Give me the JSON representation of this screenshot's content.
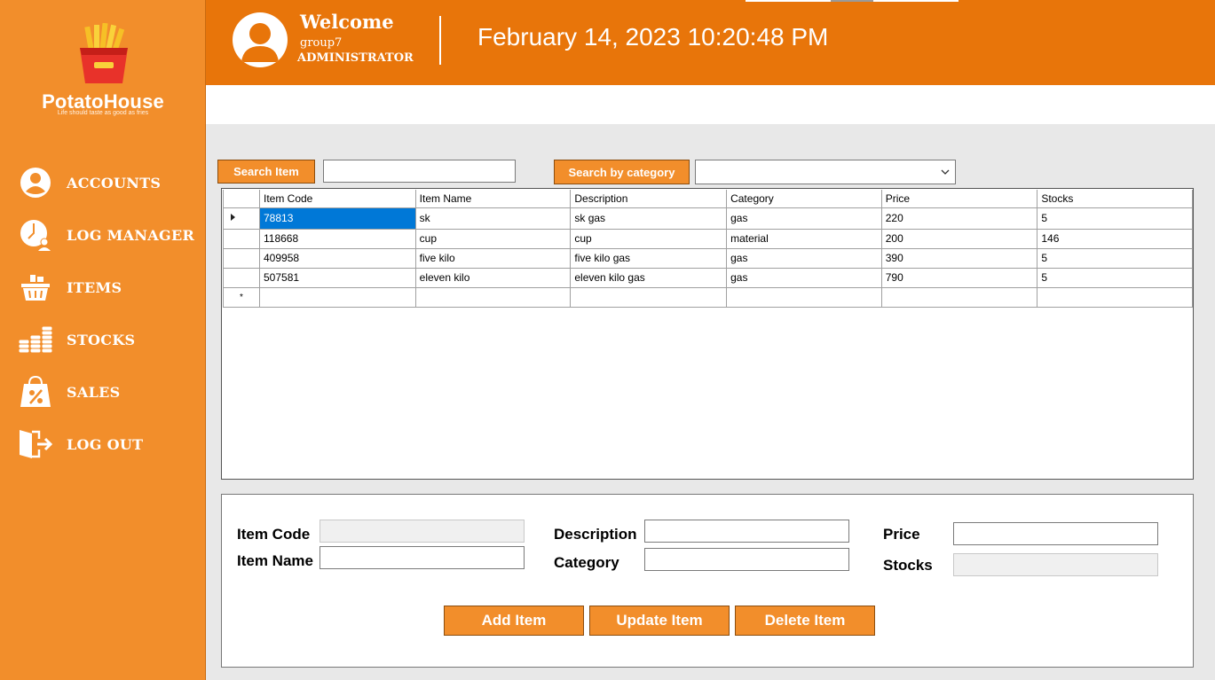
{
  "brand": {
    "name": "PotatoHouse",
    "tagline": "Life should taste as good as fries",
    "logo_icon": "fries-logo-icon"
  },
  "header": {
    "welcome": "Welcome",
    "username": "group7",
    "role": "ADMINISTRATOR",
    "datetime": "February 14, 2023 10:20:48 PM",
    "avatar_icon": "user-avatar-icon"
  },
  "sidebar": {
    "items": [
      {
        "label": "ACCOUNTS",
        "icon": "user-icon"
      },
      {
        "label": "LOG MANAGER",
        "icon": "user-clock-icon"
      },
      {
        "label": "ITEMS",
        "icon": "basket-icon"
      },
      {
        "label": "STOCKS",
        "icon": "coins-icon"
      },
      {
        "label": "SALES",
        "icon": "shopping-bag-percent-icon"
      },
      {
        "label": "LOG OUT",
        "icon": "door-exit-icon"
      }
    ]
  },
  "search": {
    "item_button": "Search Item",
    "item_value": "",
    "category_button": "Search by category",
    "category_selected": ""
  },
  "grid": {
    "columns": [
      "Item Code",
      "Item Name",
      "Description",
      "Category",
      "Price",
      "Stocks"
    ],
    "rows": [
      [
        "78813",
        "sk",
        "sk gas",
        "gas",
        "220",
        "5"
      ],
      [
        "118668",
        "cup",
        "cup",
        "material",
        "200",
        "146"
      ],
      [
        "409958",
        "five kilo",
        "five kilo gas",
        "gas",
        "390",
        "5"
      ],
      [
        "507581",
        "eleven kilo",
        "eleven kilo gas",
        "gas",
        "790",
        "5"
      ]
    ],
    "new_row_marker": "*"
  },
  "form": {
    "item_code_label": "Item Code",
    "item_name_label": "Item Name",
    "description_label": "Description",
    "category_label": "Category",
    "price_label": "Price",
    "stocks_label": "Stocks",
    "item_code_value": "",
    "item_name_value": "",
    "description_value": "",
    "category_value": "",
    "price_value": "",
    "stocks_value": ""
  },
  "actions": {
    "add": "Add Item",
    "update": "Update Item",
    "delete": "Delete Item"
  },
  "colors": {
    "sidebar": "#f28e2b",
    "header": "#e8750a",
    "button": "#f28e2b",
    "selection": "#0078d7"
  }
}
